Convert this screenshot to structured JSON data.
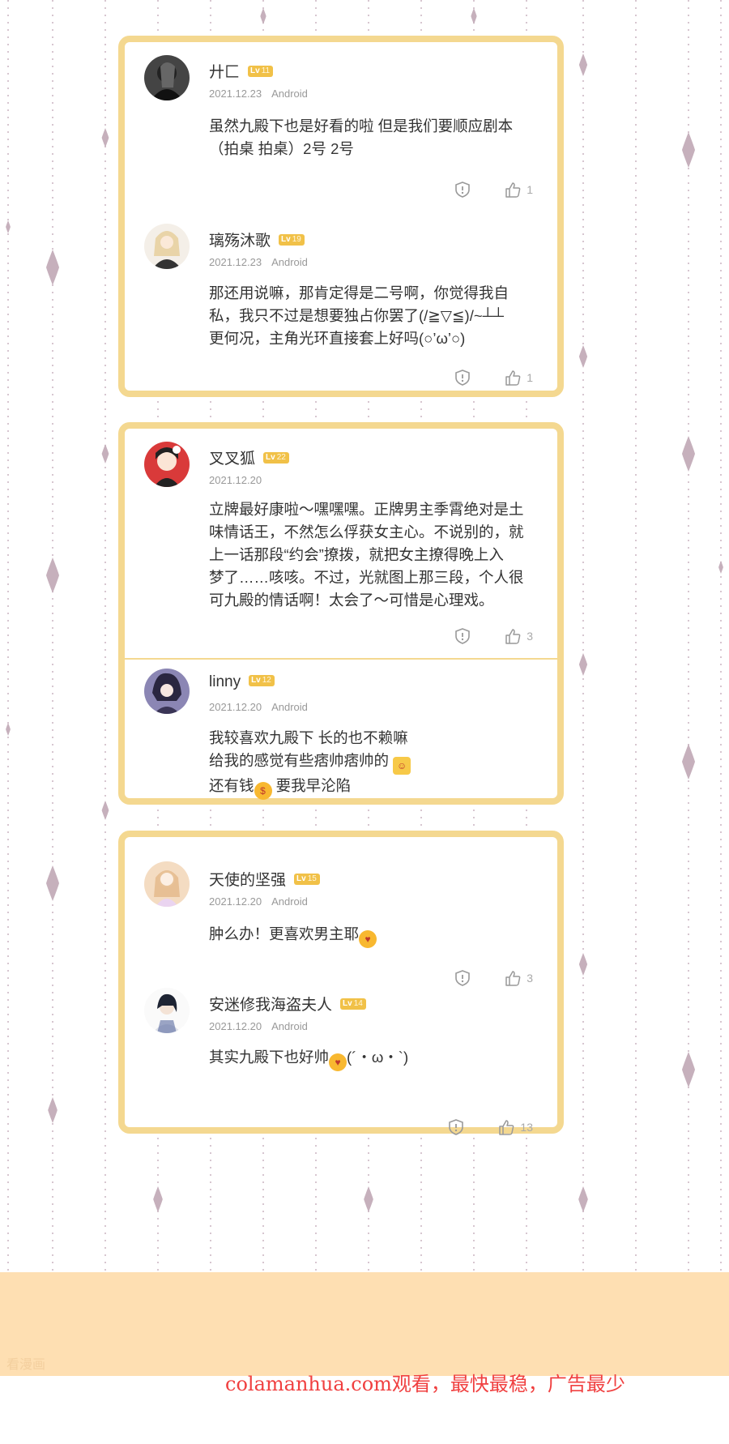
{
  "comments": {
    "c1": {
      "name": "廾匚",
      "level": "11",
      "date": "2021.12.23",
      "platform": "Android",
      "lines": [
        "虽然九殿下也是好看的啦 但是我们要顺应剧本",
        "（拍桌 拍桌）2号 2号"
      ],
      "likes": "1"
    },
    "c2": {
      "name": "璃殇沐歌",
      "level": "19",
      "date": "2021.12.23",
      "platform": "Android",
      "lines": [
        "那还用说嘛，那肯定得是二号啊，你觉得我自",
        "私，我只不过是想要独占你罢了(/≧▽≦)/~┴┴",
        "更何况，主角光环直接套上好吗(○’ω’○)"
      ],
      "likes": "1"
    },
    "c3": {
      "name": "叉叉狐",
      "level": "22",
      "date": "2021.12.20",
      "lines": [
        "立牌最好康啦～嘿嘿嘿。正牌男主季霄绝对是土",
        "味情话王，不然怎么俘获女主心。不说别的，就",
        "上一话那段“约会”撩拨，就把女主撩得晚上入",
        "梦了……咳咳。不过，光就图上那三段，个人很",
        "可九殿的情话啊！太会了～可惜是心理戏。"
      ],
      "likes": "3"
    },
    "c4": {
      "name": "linny",
      "level": "12",
      "date": "2021.12.20",
      "platform": "Android",
      "line1": "我较喜欢九殿下 长的也不赖嘛",
      "line2": "给我的感觉有些痞帅痞帅的",
      "line3a": "还有钱",
      "line3b": " 要我早沦陷"
    },
    "c5": {
      "name": "天使的坚强",
      "level": "15",
      "date": "2021.12.20",
      "platform": "Android",
      "line1": "肿么办！更喜欢男主耶",
      "likes": "3"
    },
    "c6": {
      "name": "安迷修我海盗夫人",
      "level": "14",
      "date": "2021.12.20",
      "platform": "Android",
      "line1a": "其实九殿下也好帅",
      "line1b": "(´・ω・`)",
      "likes": "13"
    }
  },
  "badge_prefix": "Lv",
  "footer": {
    "site_text": "colamanhua.com观看，最快最稳，广告最少",
    "watermark": "看漫画"
  },
  "colors": {
    "card_border": "#f4d890",
    "level_badge": "#f1c148",
    "footer_band": "#fedfb2",
    "footer_text": "#f04040",
    "decor": "#c6b0bc"
  }
}
